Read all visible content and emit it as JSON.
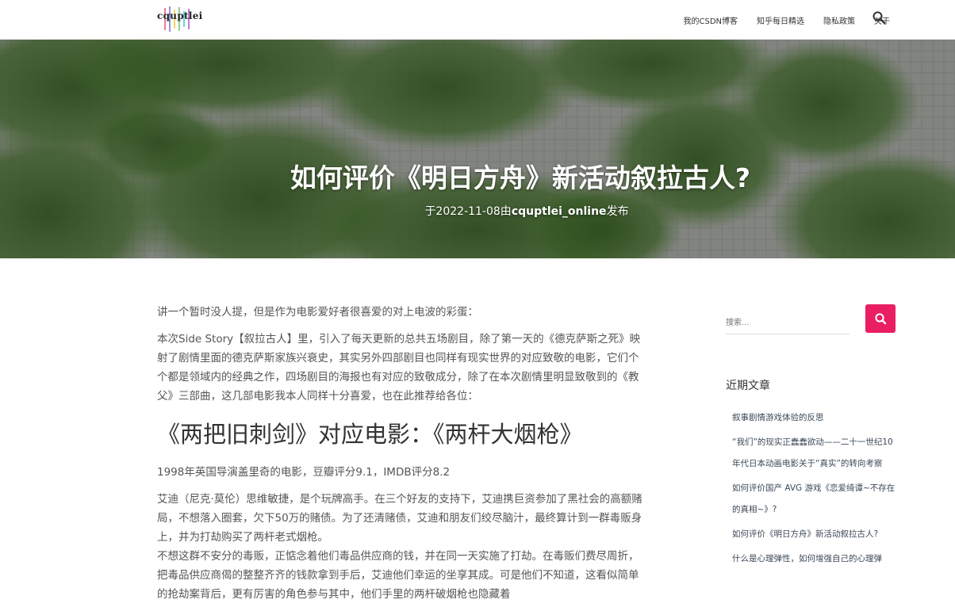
{
  "header": {
    "logo_text": "cquptlei",
    "nav": [
      "我的CSDN博客",
      "知乎每日精选",
      "隐私政策",
      "关于"
    ]
  },
  "hero": {
    "title": "如何评价《明日方舟》新活动叙拉古人?",
    "meta_prefix": "于2022-11-08由",
    "meta_author": "cquptlei_online",
    "meta_suffix": "发布"
  },
  "article": {
    "p1": "讲一个暂时没人提，但是作为电影爱好者很喜爱的对上电波的彩蛋：",
    "p2": "本次Side Story【叙拉古人】里，引入了每天更新的总共五场剧目，除了第一天的《德克萨斯之死》映射了剧情里面的德克萨斯家族兴衰史，其实另外四部剧目也同样有现实世界的对应致敬的电影，它们个个都是领域内的经典之作，四场剧目的海报也有对应的致敬成分，除了在本次剧情里明显致敬到的《教父》三部曲，这几部电影我本人同样十分喜爱，也在此推荐给各位：",
    "h2": "《两把旧刺剑》对应电影：《两杆大烟枪》",
    "p3": "1998年英国导演盖里奇的电影，豆瓣评分9.1，IMDB评分8.2",
    "p4": "艾迪（尼克·莫伦）思维敏捷，是个玩牌高手。在三个好友的支持下，艾迪携巨资参加了黑社会的高额赌局，不想落入圈套，欠下50万的赌债。为了还清赌债，艾迪和朋友们绞尽脑汁，最终算计到一群毒贩身上，并为打劫购买了两杆老式烟枪。",
    "p5": "不想这群不安分的毒贩，正惦念着他们毒品供应商的钱，并在同一天实施了打劫。在毒贩们费尽周折，把毒品供应商偈的整整齐齐的钱款拿到手后，艾迪他们幸运的坐享其成。可是他们不知道，这看似简单的抢劫案背后，更有厉害的角色参与其中，他们手里的两杆破烟枪也隐藏着"
  },
  "sidebar": {
    "search_placeholder": "搜索...",
    "recent_title": "近期文章",
    "recent": [
      "叙事剧情游戏体验的反思",
      "“我们”的现实正蠢蠢欲动——二十一世纪10 年代日本动画电影关于“真实”的转向考察",
      "如何评价国产 AVG 游戏《恋爱绮谭~不存在的真相~》?",
      "如何评价《明日方舟》新活动叙拉古人?",
      "什么是心理弹性，如何增强自己的心理弹"
    ]
  },
  "colors": {
    "accent": "#e91e63",
    "link": "#3c4858"
  },
  "icons": {
    "search": "search-icon"
  }
}
